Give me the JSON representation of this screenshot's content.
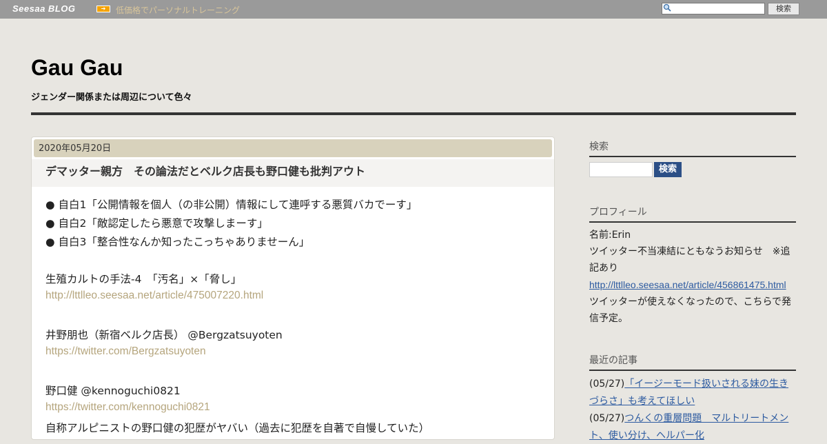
{
  "topbar": {
    "logo": "Seesaa BLOG",
    "promo": "低価格でパーソナルトレーニング",
    "search_button": "検索"
  },
  "header": {
    "title": "Gau Gau",
    "description": "ジェンダー関係または周辺について色々"
  },
  "article": {
    "date": "2020年05月20日",
    "title": "デマッター親方　その論法だとベルク店長も野口健も批判アウト",
    "lines": [
      "● 自白1「公開情報を個人（の非公開）情報にして連呼する悪質バカでーす」",
      "● 自白2「敵認定したら悪意で攻撃しまーす」",
      "● 自白3「整合性なんか知ったこっちゃありませーん」",
      "生殖カルトの手法-4　「汚名」×「脅し」",
      "http://lttlleo.seesaa.net/article/475007220.html",
      "井野朋也（新宿ベルク店長） @Bergzatsuyoten",
      "https://twitter.com/Bergzatsuyoten",
      "野口健 @kennoguchi0821",
      "https://twitter.com/kennoguchi0821",
      "自称アルピニストの野口健の犯歴がヤバい（過去に犯歴を自著で自慢していた）"
    ]
  },
  "sidebar": {
    "search": {
      "heading": "検索",
      "button": "検索"
    },
    "profile": {
      "heading": "プロフィール",
      "name": "名前:Erin",
      "notice": "ツイッター不当凍結にともなうお知らせ　※追記あり",
      "link": "http://lttlleo.seesaa.net/article/456861475.html",
      "note": "ツイッターが使えなくなったので、こちらで発信予定。"
    },
    "recent": {
      "heading": "最近の記事",
      "items": [
        {
          "date": "(05/27)",
          "title": "「イージーモード扱いされる妹の生きづらさ」も考えてほしい"
        },
        {
          "date": "(05/27)",
          "title": "つんくの重層問題　マルトリートメント、使い分け、ヘルパー化"
        }
      ]
    }
  }
}
